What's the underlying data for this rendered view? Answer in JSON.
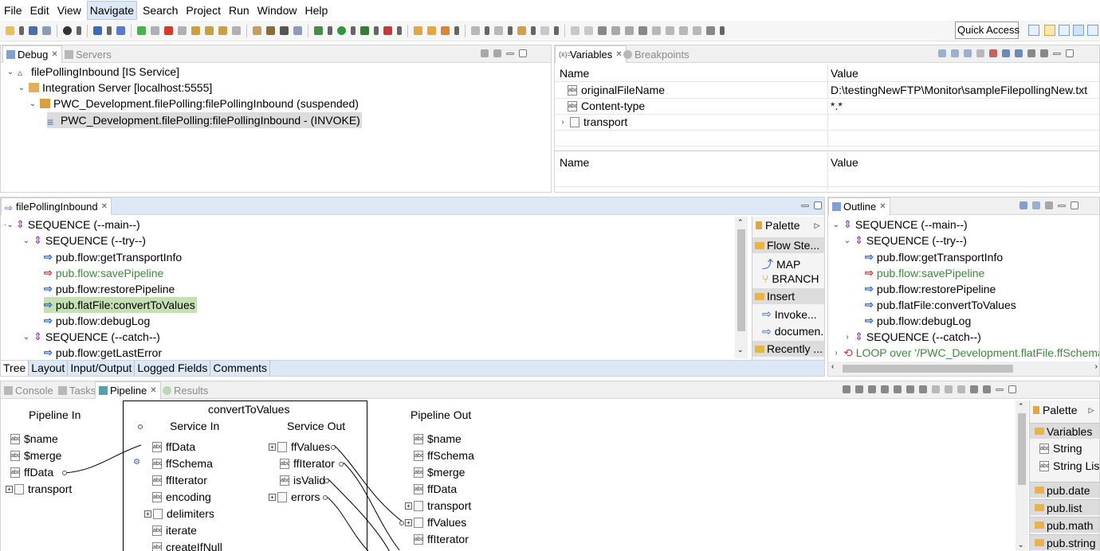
{
  "menu": [
    "File",
    "Edit",
    "View",
    "Navigate",
    "Search",
    "Project",
    "Run",
    "Window",
    "Help"
  ],
  "quick_access": "Quick Access",
  "debug": {
    "tabs": [
      "Debug",
      "Servers"
    ],
    "tree": [
      {
        "label": "filePollingInbound [IS Service]"
      },
      {
        "label": "Integration Server [localhost:5555]"
      },
      {
        "label": "PWC_Development.filePolling:filePollingInbound (suspended)"
      },
      {
        "label": "PWC_Development.filePolling:filePollingInbound - (INVOKE)"
      }
    ]
  },
  "variables": {
    "tabs": [
      "Variables",
      "Breakpoints"
    ],
    "col_name": "Name",
    "col_value": "Value",
    "rows": [
      {
        "name": "originalFileName",
        "value": "D:\\testingNewFTP\\Monitor\\sampleFilepollingNew.txt"
      },
      {
        "name": "Content-type",
        "value": "*.*"
      },
      {
        "name": "transport",
        "value": ""
      }
    ],
    "detail_name": "Name",
    "detail_value": "Value"
  },
  "editor": {
    "tab": "filePollingInbound",
    "tree": [
      {
        "label": "SEQUENCE (--main--)"
      },
      {
        "label": "SEQUENCE (--try--)"
      },
      {
        "label": "pub.flow:getTransportInfo"
      },
      {
        "label": "pub.flow:savePipeline"
      },
      {
        "label": "pub.flow:restorePipeline"
      },
      {
        "label": "pub.flatFile:convertToValues"
      },
      {
        "label": "pub.flow:debugLog"
      },
      {
        "label": "SEQUENCE (--catch--)"
      },
      {
        "label": "pub.flow:getLastError"
      }
    ],
    "bottom_tabs": [
      "Tree",
      "Layout",
      "Input/Output",
      "Logged Fields",
      "Comments"
    ],
    "palette": {
      "title": "Palette",
      "flow_steps": "Flow Ste...",
      "map": "MAP",
      "branch": "BRANCH",
      "insert": "Insert",
      "invoke": "Invoke...",
      "document": "documen...",
      "recently": "Recently ..."
    }
  },
  "outline": {
    "tab": "Outline",
    "tree": [
      {
        "label": "SEQUENCE (--main--)"
      },
      {
        "label": "SEQUENCE (--try--)"
      },
      {
        "label": "pub.flow:getTransportInfo"
      },
      {
        "label": "pub.flow:savePipeline"
      },
      {
        "label": "pub.flow:restorePipeline"
      },
      {
        "label": "pub.flatFile:convertToValues"
      },
      {
        "label": "pub.flow:debugLog"
      },
      {
        "label": "SEQUENCE (--catch--)"
      },
      {
        "label": "LOOP over '/PWC_Development.flatFile.ffSchemas:ffSc"
      }
    ]
  },
  "pipeline": {
    "tabs": [
      "Console",
      "Tasks",
      "Pipeline",
      "Results"
    ],
    "pipeline_in": "Pipeline In",
    "service_title": "convertToValues",
    "service_in": "Service In",
    "service_out": "Service Out",
    "pipeline_out": "Pipeline Out",
    "in_fields": [
      "$name",
      "$merge",
      "ffData",
      "transport"
    ],
    "svc_in_fields": [
      "ffData",
      "ffSchema",
      "ffIterator",
      "encoding",
      "delimiters",
      "iterate",
      "createIfNull"
    ],
    "svc_out_fields": [
      "ffValues",
      "ffIterator",
      "isValid",
      "errors"
    ],
    "out_fields": [
      "$name",
      "ffSchema",
      "$merge",
      "ffData",
      "transport",
      "ffValues",
      "ffIterator"
    ],
    "palette": {
      "title": "Palette",
      "variables": "Variables",
      "string": "String",
      "string_list": "String List",
      "folders": [
        "pub.date",
        "pub.list",
        "pub.math",
        "pub.string"
      ]
    }
  },
  "colors": {
    "accent": "#dde8f6",
    "highlight": "#c5e0b3",
    "flow_arrow": "#2d5fc4"
  }
}
